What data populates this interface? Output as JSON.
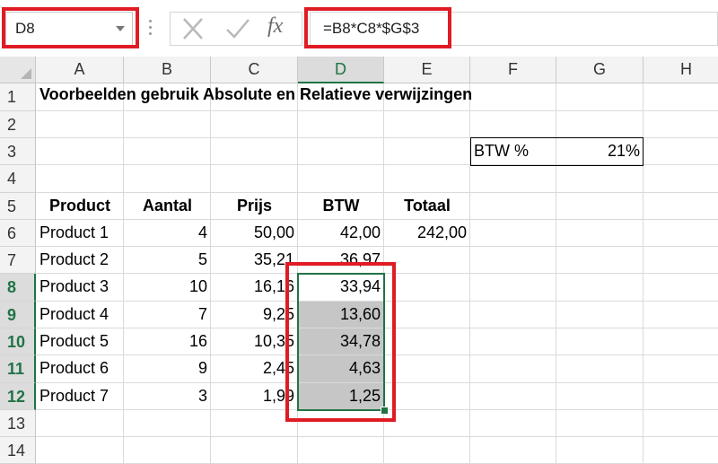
{
  "name_box": {
    "value": "D8"
  },
  "formula_bar": {
    "cancel_icon": "x-icon",
    "enter_icon": "check-icon",
    "fx_label": "fx",
    "formula": "=B8*C8*$G$3"
  },
  "columns": [
    "A",
    "B",
    "C",
    "D",
    "E",
    "F",
    "G",
    "H"
  ],
  "rows": [
    "1",
    "2",
    "3",
    "4",
    "5",
    "6",
    "7",
    "8",
    "9",
    "10",
    "11",
    "12",
    "13",
    "14"
  ],
  "selected": {
    "column": "D",
    "rows": [
      "8",
      "9",
      "10",
      "11",
      "12"
    ]
  },
  "title": "Voorbeelden gebruik Absolute en Relatieve verwijzingen",
  "btw": {
    "label": "BTW %",
    "value": "21%"
  },
  "table": {
    "headers": [
      "Product",
      "Aantal",
      "Prijs",
      "BTW",
      "Totaal"
    ],
    "rows": [
      [
        "Product 1",
        "4",
        "50,00",
        "42,00",
        "242,00"
      ],
      [
        "Product 2",
        "5",
        "35,21",
        "36,97",
        ""
      ],
      [
        "Product 3",
        "10",
        "16,16",
        "33,94",
        ""
      ],
      [
        "Product 4",
        "7",
        "9,25",
        "13,60",
        ""
      ],
      [
        "Product 5",
        "16",
        "10,35",
        "34,78",
        ""
      ],
      [
        "Product 6",
        "9",
        "2,45",
        "4,63",
        ""
      ],
      [
        "Product 7",
        "3",
        "1,99",
        "1,25",
        ""
      ]
    ]
  },
  "colors": {
    "selection": "#217346",
    "highlight": "#e01b24",
    "shade": "#c6c6c6"
  }
}
